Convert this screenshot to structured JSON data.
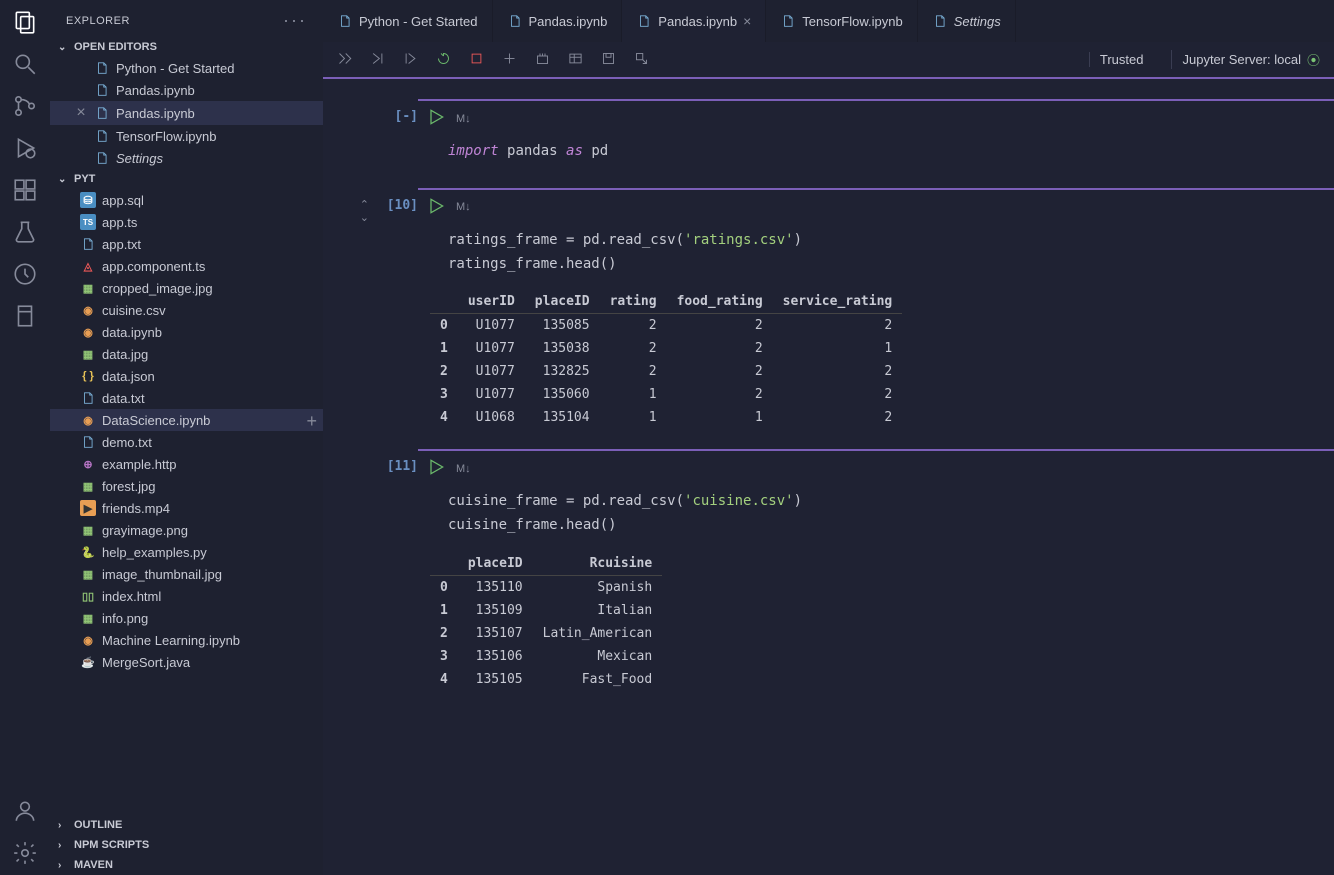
{
  "sidebar": {
    "title": "EXPLORER",
    "openEditors": {
      "title": "OPEN EDITORS",
      "items": [
        {
          "name": "Python - Get Started",
          "icon": "file",
          "sel": false,
          "close": false,
          "italic": false
        },
        {
          "name": "Pandas.ipynb",
          "icon": "file",
          "sel": false,
          "close": false,
          "italic": false
        },
        {
          "name": "Pandas.ipynb",
          "icon": "file",
          "sel": true,
          "close": true,
          "italic": false
        },
        {
          "name": "TensorFlow.ipynb",
          "icon": "file",
          "sel": false,
          "close": false,
          "italic": false
        },
        {
          "name": "Settings",
          "icon": "file",
          "sel": false,
          "close": false,
          "italic": true
        }
      ]
    },
    "folder": {
      "title": "PYT",
      "files": [
        {
          "name": "app.sql",
          "icon": "db"
        },
        {
          "name": "app.ts",
          "icon": "ts"
        },
        {
          "name": "app.txt",
          "icon": "txt"
        },
        {
          "name": "app.component.ts",
          "icon": "ng"
        },
        {
          "name": "cropped_image.jpg",
          "icon": "img"
        },
        {
          "name": "cuisine.csv",
          "icon": "jup"
        },
        {
          "name": "data.ipynb",
          "icon": "jup"
        },
        {
          "name": "data.jpg",
          "icon": "img"
        },
        {
          "name": "data.json",
          "icon": "json"
        },
        {
          "name": "data.txt",
          "icon": "txt"
        },
        {
          "name": "DataScience.ipynb",
          "icon": "jup",
          "sel": true
        },
        {
          "name": "demo.txt",
          "icon": "txt"
        },
        {
          "name": "example.http",
          "icon": "http"
        },
        {
          "name": "forest.jpg",
          "icon": "img"
        },
        {
          "name": "friends.mp4",
          "icon": "mp4"
        },
        {
          "name": "grayimage.png",
          "icon": "img"
        },
        {
          "name": "help_examples.py",
          "icon": "py"
        },
        {
          "name": "image_thumbnail.jpg",
          "icon": "img"
        },
        {
          "name": "index.html",
          "icon": "html"
        },
        {
          "name": "info.png",
          "icon": "img"
        },
        {
          "name": "Machine Learning.ipynb",
          "icon": "jup"
        },
        {
          "name": "MergeSort.java",
          "icon": "java"
        }
      ]
    },
    "outline": "OUTLINE",
    "npm": "NPM SCRIPTS",
    "maven": "MAVEN"
  },
  "tabs": [
    {
      "label": "Python - Get Started",
      "active": false,
      "close": false,
      "italic": false
    },
    {
      "label": "Pandas.ipynb",
      "active": false,
      "close": false,
      "italic": false
    },
    {
      "label": "Pandas.ipynb",
      "active": true,
      "close": true,
      "italic": false
    },
    {
      "label": "TensorFlow.ipynb",
      "active": false,
      "close": false,
      "italic": false
    },
    {
      "label": "Settings",
      "active": false,
      "close": false,
      "italic": true
    }
  ],
  "toolbar": {
    "trusted": "Trusted",
    "server": "Jupyter Server: local"
  },
  "cells": [
    {
      "exec": "[-]",
      "md": "M↓",
      "fold": "",
      "code": "<span class='kw'>import</span> <span class='pn'>pandas</span> <span class='kw2'>as</span> <span class='pn'>pd</span>"
    },
    {
      "exec": "[10]",
      "md": "M↓",
      "fold": "both",
      "code": "<span class='pn'>ratings_frame = pd.read_csv(</span><span class='str'>'ratings.csv'</span><span class='pn'>)</span><br><span class='pn'>ratings_frame.head()</span>",
      "table": {
        "head": [
          "",
          "userID",
          "placeID",
          "rating",
          "food_rating",
          "service_rating"
        ],
        "rows": [
          [
            "0",
            "U1077",
            "135085",
            "2",
            "2",
            "2"
          ],
          [
            "1",
            "U1077",
            "135038",
            "2",
            "2",
            "1"
          ],
          [
            "2",
            "U1077",
            "132825",
            "2",
            "2",
            "2"
          ],
          [
            "3",
            "U1077",
            "135060",
            "1",
            "2",
            "2"
          ],
          [
            "4",
            "U1068",
            "135104",
            "1",
            "1",
            "2"
          ]
        ]
      }
    },
    {
      "exec": "[11]",
      "md": "M↓",
      "fold": "",
      "code": "<span class='pn'>cuisine_frame = pd.read_csv(</span><span class='str'>'cuisine.csv'</span><span class='pn'>)</span><br><span class='pn'>cuisine_frame.head()</span>",
      "table": {
        "head": [
          "",
          "placeID",
          "Rcuisine"
        ],
        "rows": [
          [
            "0",
            "135110",
            "Spanish"
          ],
          [
            "1",
            "135109",
            "Italian"
          ],
          [
            "2",
            "135107",
            "Latin_American"
          ],
          [
            "3",
            "135106",
            "Mexican"
          ],
          [
            "4",
            "135105",
            "Fast_Food"
          ]
        ]
      }
    }
  ]
}
